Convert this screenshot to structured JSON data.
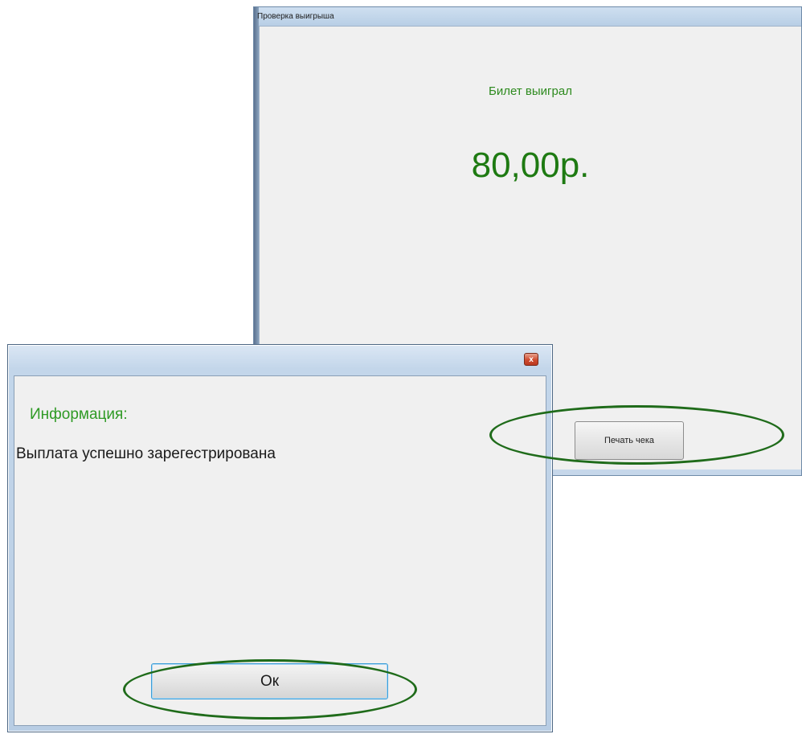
{
  "back_window": {
    "title": "Проверка выигрыша",
    "status_text": "Билет выиграл",
    "prize_amount": "80,00р.",
    "print_button_label": "Печать чека",
    "accent_color": "#1e7a12"
  },
  "info_dialog": {
    "close_icon": "close-icon",
    "close_glyph": "x",
    "label": "Информация:",
    "message": "Выплата успешно зарегестрирована",
    "ok_button_label": "Ок",
    "label_color": "#2f9a25"
  },
  "annotations": {
    "oval_color": "#1f6b1a"
  }
}
